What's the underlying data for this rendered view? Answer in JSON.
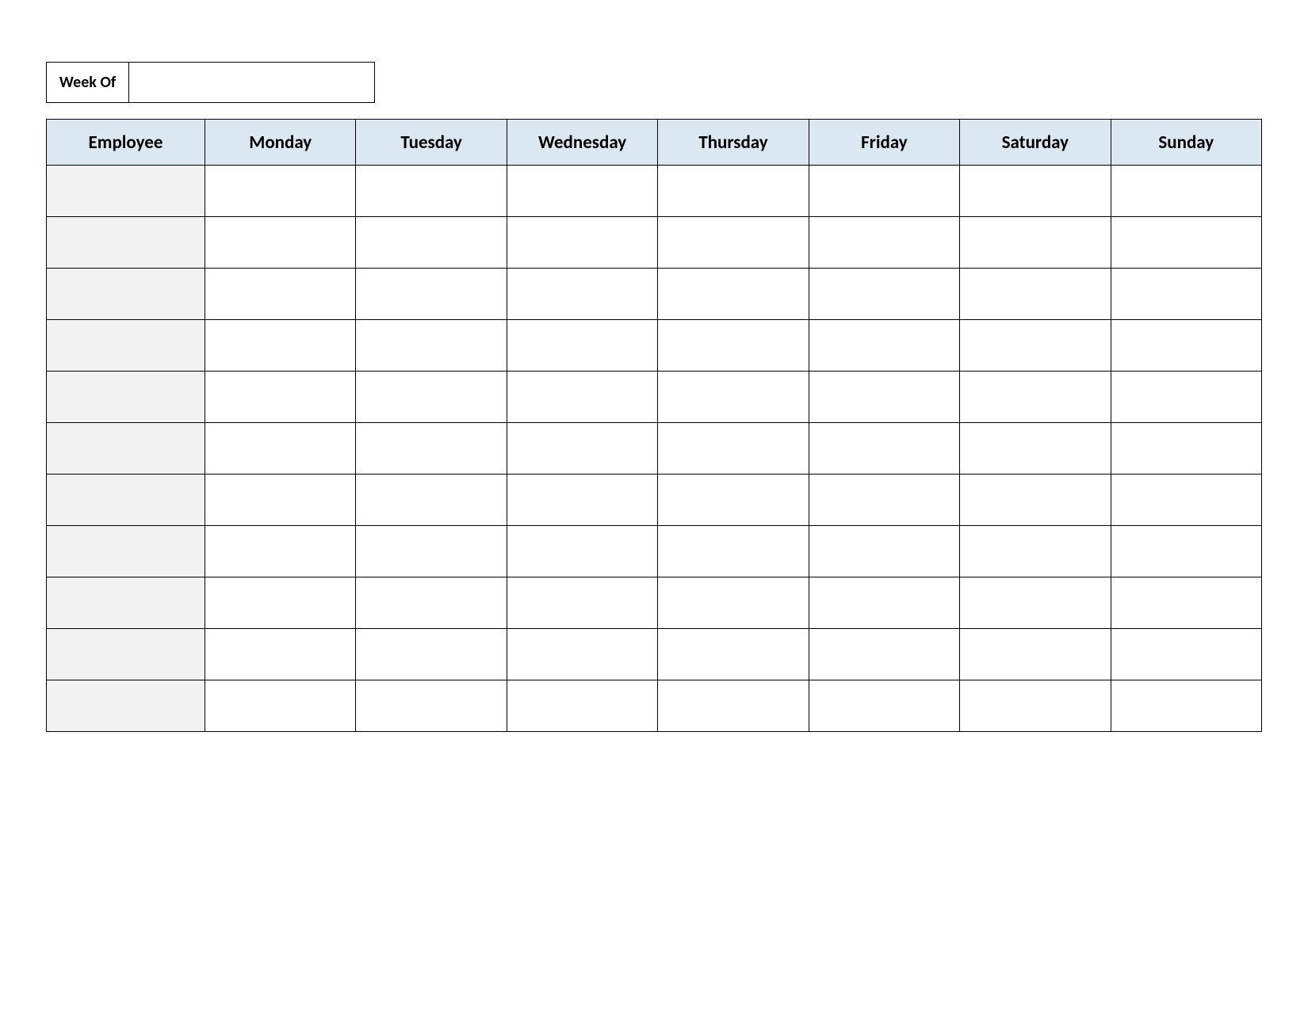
{
  "weekof": {
    "label": "Week Of",
    "value": ""
  },
  "table": {
    "headers": [
      "Employee",
      "Monday",
      "Tuesday",
      "Wednesday",
      "Thursday",
      "Friday",
      "Saturday",
      "Sunday"
    ],
    "rows": [
      {
        "employee": "",
        "mon": "",
        "tue": "",
        "wed": "",
        "thu": "",
        "fri": "",
        "sat": "",
        "sun": ""
      },
      {
        "employee": "",
        "mon": "",
        "tue": "",
        "wed": "",
        "thu": "",
        "fri": "",
        "sat": "",
        "sun": ""
      },
      {
        "employee": "",
        "mon": "",
        "tue": "",
        "wed": "",
        "thu": "",
        "fri": "",
        "sat": "",
        "sun": ""
      },
      {
        "employee": "",
        "mon": "",
        "tue": "",
        "wed": "",
        "thu": "",
        "fri": "",
        "sat": "",
        "sun": ""
      },
      {
        "employee": "",
        "mon": "",
        "tue": "",
        "wed": "",
        "thu": "",
        "fri": "",
        "sat": "",
        "sun": ""
      },
      {
        "employee": "",
        "mon": "",
        "tue": "",
        "wed": "",
        "thu": "",
        "fri": "",
        "sat": "",
        "sun": ""
      },
      {
        "employee": "",
        "mon": "",
        "tue": "",
        "wed": "",
        "thu": "",
        "fri": "",
        "sat": "",
        "sun": ""
      },
      {
        "employee": "",
        "mon": "",
        "tue": "",
        "wed": "",
        "thu": "",
        "fri": "",
        "sat": "",
        "sun": ""
      },
      {
        "employee": "",
        "mon": "",
        "tue": "",
        "wed": "",
        "thu": "",
        "fri": "",
        "sat": "",
        "sun": ""
      },
      {
        "employee": "",
        "mon": "",
        "tue": "",
        "wed": "",
        "thu": "",
        "fri": "",
        "sat": "",
        "sun": ""
      },
      {
        "employee": "",
        "mon": "",
        "tue": "",
        "wed": "",
        "thu": "",
        "fri": "",
        "sat": "",
        "sun": ""
      }
    ]
  }
}
